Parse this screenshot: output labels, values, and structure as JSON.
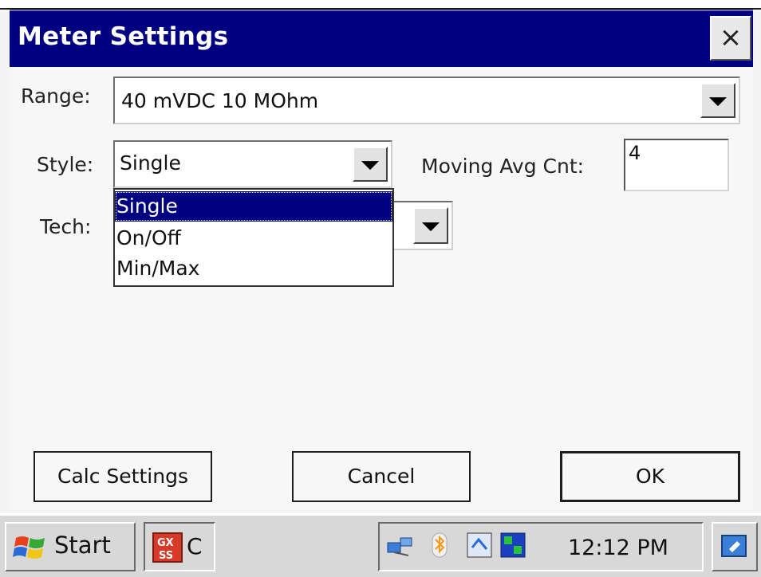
{
  "window": {
    "title": "Meter Settings",
    "close_glyph": "×"
  },
  "form": {
    "range": {
      "label": "Range:",
      "value": "40 mVDC 10 MOhm"
    },
    "style": {
      "label": "Style:",
      "value": "Single",
      "options": [
        "Single",
        "On/Off",
        "Min/Max"
      ],
      "selected_index": 0
    },
    "tech": {
      "label": "Tech:"
    },
    "moving_avg": {
      "label": "Moving Avg Cnt:",
      "value": "4"
    }
  },
  "buttons": {
    "calc_settings": "Calc Settings",
    "cancel": "Cancel",
    "ok": "OK"
  },
  "taskbar": {
    "start_label": "Start",
    "app_label": "GX SS",
    "app_text_fragment": "C",
    "clock": "12:12 PM"
  },
  "colors": {
    "title_bar": "#000080",
    "selection": "#000080"
  }
}
